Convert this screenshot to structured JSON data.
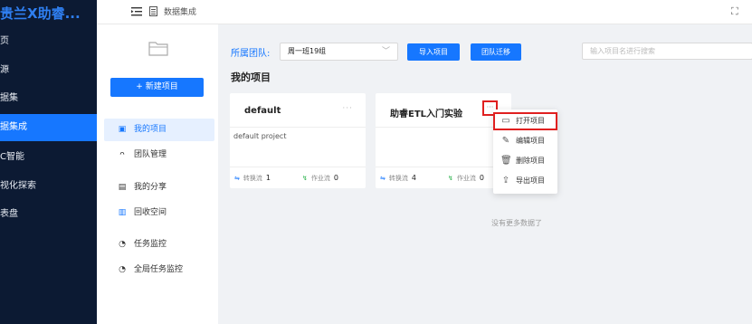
{
  "nav": {
    "title": "贵兰X助睿...",
    "items": [
      {
        "label": "页",
        "active": false
      },
      {
        "label": "源",
        "active": false
      },
      {
        "label": "据集",
        "active": false
      },
      {
        "label": "据集成",
        "active": true
      },
      {
        "label": "C智能",
        "active": false
      },
      {
        "label": "视化探索",
        "active": false
      },
      {
        "label": "表盘",
        "active": false
      }
    ]
  },
  "header": {
    "breadcrumb": "数据集成",
    "menu_icon": "menu-fold-icon",
    "expand_icon": "fullscreen-icon"
  },
  "sidebar": {
    "new_button": "+ 新建项目",
    "items": [
      {
        "label": "我的项目",
        "icon": "▣"
      },
      {
        "label": "团队管理",
        "icon": "ᴖ"
      },
      {
        "label": "我的分享",
        "icon": "▤"
      },
      {
        "label": "回收空间",
        "icon": "▥"
      },
      {
        "label": "任务监控",
        "icon": "◔"
      },
      {
        "label": "全局任务监控",
        "icon": "◔"
      }
    ]
  },
  "main": {
    "team_label": "所属团队:",
    "team_value": "周一班19组",
    "import_btn": "导入项目",
    "migrate_btn": "团队迁移",
    "search_placeholder": "输入项目名进行搜索",
    "section_title": "我的项目",
    "no_more": "没有更多数据了",
    "cards": [
      {
        "title": "default",
        "desc": "default project",
        "convert_label": "转换流",
        "convert_count": "1",
        "job_label": "作业流",
        "job_count": "0"
      },
      {
        "title": "助睿ETL入门实验",
        "desc": "",
        "convert_label": "转换流",
        "convert_count": "4",
        "job_label": "作业流",
        "job_count": "0"
      }
    ],
    "menu": [
      {
        "label": "打开项目",
        "icon": "▭"
      },
      {
        "label": "编辑项目",
        "icon": "✎"
      },
      {
        "label": "删除项目",
        "icon": "🗑"
      },
      {
        "label": "导出项目",
        "icon": "⇪"
      }
    ]
  },
  "colors": {
    "primary": "#1677ff",
    "nav_bg": "#0c1a33",
    "highlight": "#e02020"
  }
}
